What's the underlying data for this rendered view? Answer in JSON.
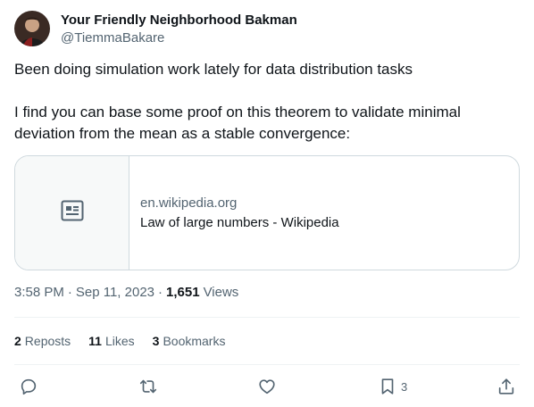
{
  "author": {
    "display_name": "Your Friendly Neighborhood Bakman",
    "handle": "@TiemmaBakare"
  },
  "post": {
    "paragraph1": "Been doing simulation work lately for data distribution tasks",
    "paragraph2": "I find you can base some proof on this theorem to validate minimal deviation from the mean as a stable convergence:"
  },
  "link_card": {
    "domain": "en.wikipedia.org",
    "title": "Law of large numbers - Wikipedia",
    "icon": "article-icon"
  },
  "meta": {
    "time": "3:58 PM",
    "separator": "·",
    "date": "Sep 11, 2023",
    "views_count": "1,651",
    "views_label": "Views"
  },
  "stats": {
    "reposts_count": "2",
    "reposts_label": "Reposts",
    "likes_count": "11",
    "likes_label": "Likes",
    "bookmarks_count": "3",
    "bookmarks_label": "Bookmarks"
  },
  "actions": {
    "reply_icon": "reply-icon",
    "repost_icon": "repost-icon",
    "like_icon": "heart-icon",
    "bookmark_icon": "bookmark-icon",
    "bookmark_count": "3",
    "share_icon": "share-icon"
  },
  "colors": {
    "text_primary": "#0f1419",
    "text_secondary": "#536471",
    "border": "#cfd9de",
    "divider": "#eff3f4"
  }
}
